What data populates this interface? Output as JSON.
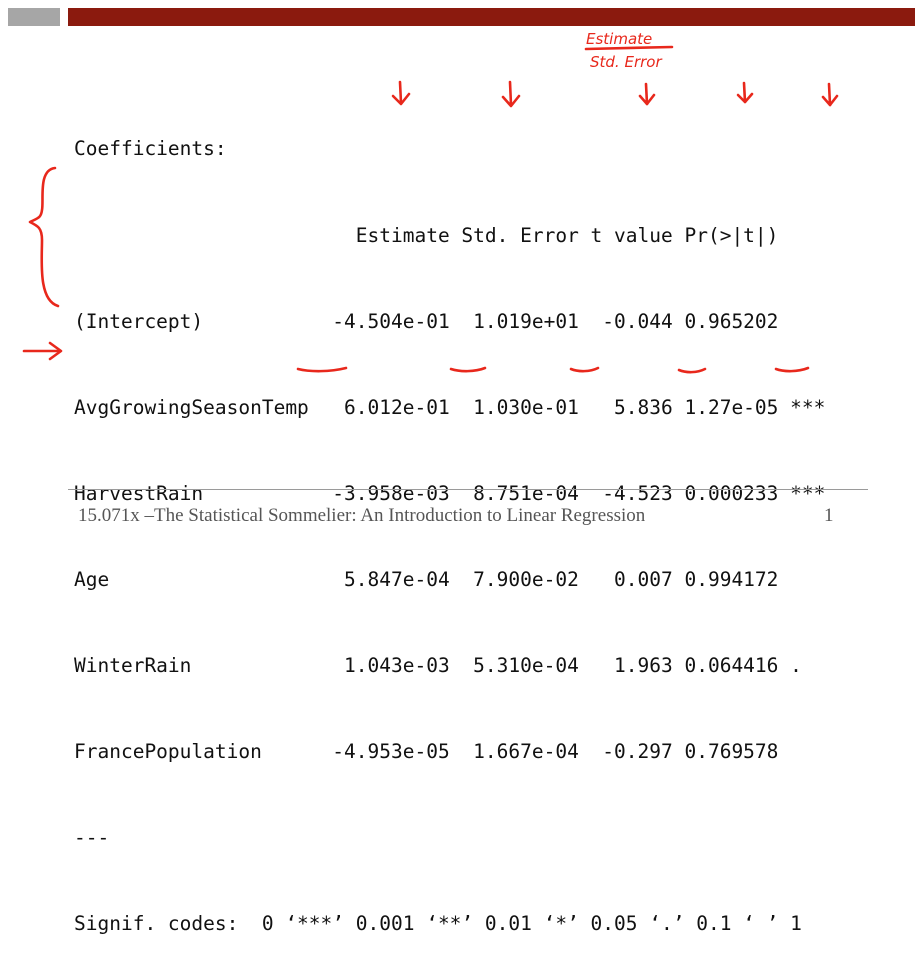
{
  "header": {
    "label": "Coefficients:"
  },
  "columns": [
    "Estimate",
    "Std. Error",
    "t value",
    "Pr(>|t|)"
  ],
  "rows": [
    {
      "name": "(Intercept)",
      "estimate": "-4.504e-01",
      "stderr": "1.019e+01",
      "t": "-0.044",
      "p": "0.965202",
      "sig": ""
    },
    {
      "name": "AvgGrowingSeasonTemp",
      "estimate": "6.012e-01",
      "stderr": "1.030e-01",
      "t": "5.836",
      "p": "1.27e-05",
      "sig": "***"
    },
    {
      "name": "HarvestRain",
      "estimate": "-3.958e-03",
      "stderr": "8.751e-04",
      "t": "-4.523",
      "p": "0.000233",
      "sig": "***"
    },
    {
      "name": "Age",
      "estimate": "5.847e-04",
      "stderr": "7.900e-02",
      "t": "0.007",
      "p": "0.994172",
      "sig": ""
    },
    {
      "name": "WinterRain",
      "estimate": "1.043e-03",
      "stderr": "5.310e-04",
      "t": "1.963",
      "p": "0.064416",
      "sig": "."
    },
    {
      "name": "FrancePopulation",
      "estimate": "-4.953e-05",
      "stderr": "1.667e-04",
      "t": "-0.297",
      "p": "0.769578",
      "sig": ""
    }
  ],
  "separator": "---",
  "signif_line": "Signif. codes:  0 ‘***’ 0.001 ‘**’ 0.01 ‘*’ 0.05 ‘.’ 0.1 ‘ ’ 1",
  "annotations": {
    "estimate_label": "Estimate",
    "stderr_label": "Std. Error",
    "color": "#e8281c"
  },
  "footer": {
    "title": "15.071x –The Statistical Sommelier: An Introduction to Linear Regression",
    "page": "1"
  },
  "colors": {
    "brand_bar": "#8b1a0e",
    "gray_block": "#a6a6a6",
    "ink": "#111111"
  }
}
